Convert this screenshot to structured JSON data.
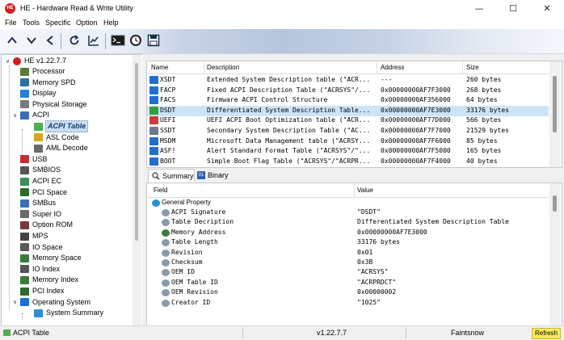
{
  "window": {
    "title": "HE - Hardware Read & Write Utility",
    "icon_label": "HE"
  },
  "menu": [
    "File",
    "Tools",
    "Specific",
    "Option",
    "Help"
  ],
  "toolbar": {
    "icons": [
      "chevron-up-icon",
      "chevron-down-icon",
      "back-icon",
      "refresh-icon",
      "chart-icon",
      "terminal-icon",
      "timer-icon",
      "save-icon"
    ]
  },
  "tree": {
    "root": "HE v1.22.7.7",
    "items": [
      {
        "label": "Processor",
        "color": "#5a7a3a"
      },
      {
        "label": "Memory SPD",
        "color": "#2f6f9f"
      },
      {
        "label": "Display",
        "color": "#2a7fd4"
      },
      {
        "label": "Physical Storage",
        "color": "#7a7a7a"
      },
      {
        "label": "ACPI",
        "color": "#3a6fb5"
      },
      {
        "label": "ACPI Table",
        "color": "#4caf50"
      },
      {
        "label": "ASL Code",
        "color": "#d9a520"
      },
      {
        "label": "AML Decode",
        "color": "#6a6a6a"
      },
      {
        "label": "USB",
        "color": "#c03030"
      },
      {
        "label": "SMBIOS",
        "color": "#555555"
      },
      {
        "label": "ACPI EC",
        "color": "#3a8f5a"
      },
      {
        "label": "PCI Space",
        "color": "#2d6a2d"
      },
      {
        "label": "SMBus",
        "color": "#3a6fb5"
      },
      {
        "label": "Super IO",
        "color": "#6a6a6a"
      },
      {
        "label": "Option ROM",
        "color": "#7a3a3a"
      },
      {
        "label": "MPS",
        "color": "#444444"
      },
      {
        "label": "IO Space",
        "color": "#5a5a5a"
      },
      {
        "label": "Memory Space",
        "color": "#3a7a3a"
      },
      {
        "label": "IO Index",
        "color": "#555555"
      },
      {
        "label": "Memory Index",
        "color": "#3a7a3a"
      },
      {
        "label": "PCI Index",
        "color": "#2d6a2d"
      },
      {
        "label": "Operating System",
        "color": "#1f6fd0"
      },
      {
        "label": "System Summary",
        "color": "#2a8fd4"
      }
    ]
  },
  "table": {
    "columns": [
      "Name",
      "Description",
      "Address",
      "Size"
    ],
    "rows": [
      {
        "name": "XSDT",
        "description": "Extended System Description table (\"ACR...",
        "address": "---",
        "size": "260 bytes",
        "color": "#1f6fd0"
      },
      {
        "name": "FACP",
        "description": "Fixed ACPI Description Table (\"ACRSYS\"/...",
        "address": "0x00000000AF7F3000",
        "size": "268 bytes",
        "color": "#1f6fd0"
      },
      {
        "name": "FACS",
        "description": "Firmware ACPI Control Structure",
        "address": "0x00000000AF356000",
        "size": "64 bytes",
        "color": "#1f6fd0"
      },
      {
        "name": "DSDT",
        "description": "Differentiated System Description Table...",
        "address": "0x00000000AF7E3000",
        "size": "33176 bytes",
        "color": "#2e9e3e"
      },
      {
        "name": "UEFI",
        "description": "UEFI ACPI Boot Optimization table (\"ACR...",
        "address": "0x00000000AF77D000",
        "size": "566 bytes",
        "color": "#d03a3a"
      },
      {
        "name": "SSDT",
        "description": "Secondary System Description Table (\"AC...",
        "address": "0x00000000AF7F7000",
        "size": "21529 bytes",
        "color": "#6a7a8a"
      },
      {
        "name": "MSDM",
        "description": "Microsoft Data Management table (\"ACRSY...",
        "address": "0x00000000AF7F6000",
        "size": "85 bytes",
        "color": "#1f6fd0"
      },
      {
        "name": "ASF!",
        "description": "Alert Standard Format Table (\"ACRSYS\"/\"...",
        "address": "0x00000000AF7F5000",
        "size": "165 bytes",
        "color": "#1f6fd0"
      },
      {
        "name": "BOOT",
        "description": "Simple Boot Flag Table (\"ACRSYS\"/\"ACRPR...",
        "address": "0x00000000AF7F4000",
        "size": "40 bytes",
        "color": "#1f6fd0"
      }
    ]
  },
  "tabs": [
    "Summary",
    "Binary"
  ],
  "details": {
    "columns": [
      "Field",
      "Value"
    ],
    "group": "General Property",
    "rows": [
      {
        "field": "ACPI Signature",
        "value": "\"DSDT\"",
        "color": "#8a9aab"
      },
      {
        "field": "Table Decription",
        "value": "Differentiated System Description Table",
        "color": "#8a9aab"
      },
      {
        "field": "Memory Address",
        "value": "0x00000000AF7E3000",
        "color": "#3a7a3a"
      },
      {
        "field": "Table Length",
        "value": "33176 bytes",
        "color": "#8a9aab"
      },
      {
        "field": "Revision",
        "value": "0x01",
        "color": "#8a9aab"
      },
      {
        "field": "Checksum",
        "value": "0x3B",
        "color": "#8a9aab"
      },
      {
        "field": "OEM ID",
        "value": "\"ACRSYS\"",
        "color": "#8a9aab"
      },
      {
        "field": "OEM Table ID",
        "value": "\"ACRPRDCT\"",
        "color": "#8a9aab"
      },
      {
        "field": "OEM Revision",
        "value": "0x00000002",
        "color": "#8a9aab"
      },
      {
        "field": "Creator ID",
        "value": "\"1025\"",
        "color": "#8a9aab"
      }
    ]
  },
  "status": {
    "left": "ACPI Table",
    "version": "v1.22.7.7",
    "author": "Faintsnow",
    "refresh": "Refresh"
  }
}
